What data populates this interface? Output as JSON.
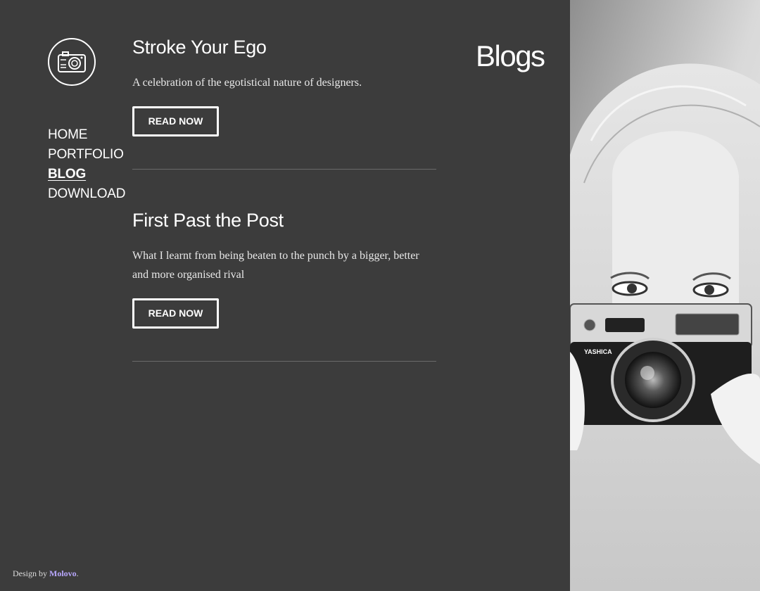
{
  "site": {
    "logo_icon": "camera-icon",
    "page_heading": "Blogs"
  },
  "nav": {
    "items": [
      {
        "label": "HOME",
        "active": false
      },
      {
        "label": "PORTFOLIO",
        "active": false
      },
      {
        "label": "BLOG",
        "active": true
      },
      {
        "label": "DOWNLOAD",
        "active": false
      }
    ]
  },
  "posts": [
    {
      "title": "Stroke Your Ego",
      "excerpt": "A celebration of the egotistical nature of designers.",
      "button_label": "READ NOW"
    },
    {
      "title": "First Past the Post",
      "excerpt": "What I learnt from being beaten to the punch by a bigger, better and more organised rival",
      "button_label": "READ NOW"
    }
  ],
  "footer": {
    "prefix": "Design by ",
    "author": "Molovo",
    "suffix": "."
  },
  "hero": {
    "camera_brand": "YASHICA",
    "colors": {
      "background": "#3c3c3c",
      "link": "#b9a8ff"
    }
  }
}
